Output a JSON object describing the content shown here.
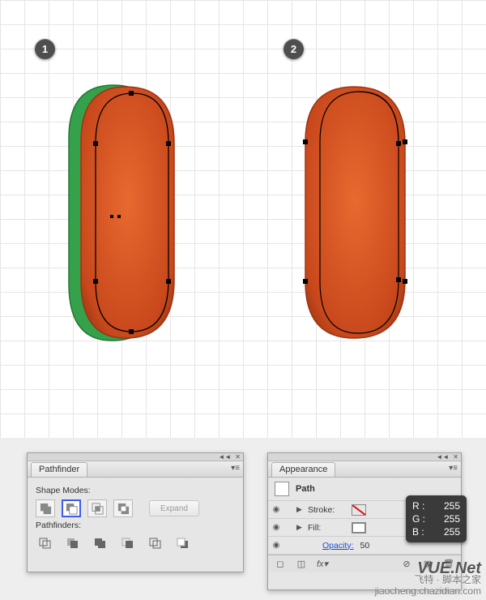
{
  "canvas": {
    "step1_label": "1",
    "step2_label": "2"
  },
  "pathfinder": {
    "tab": "Pathfinder",
    "shape_modes_label": "Shape Modes:",
    "expand_label": "Expand",
    "pathfinders_label": "Pathfinders:",
    "modes": [
      "unite",
      "minus-front",
      "intersect",
      "exclude"
    ],
    "active_mode_index": 1,
    "ops": [
      "divide",
      "trim",
      "merge",
      "crop",
      "outline",
      "minus-back"
    ]
  },
  "appearance": {
    "tab": "Appearance",
    "object_type": "Path",
    "rows": {
      "stroke_label": "Stroke:",
      "fill_label": "Fill:",
      "opacity_label": "Opacity:",
      "opacity_value": "50"
    },
    "footer_icons": [
      "no-style",
      "duplicate",
      "fx",
      "clear",
      "new",
      "delete"
    ]
  },
  "rgb": {
    "r_label": "R :",
    "g_label": "G :",
    "b_label": "B :",
    "r": "255",
    "g": "255",
    "b": "255"
  },
  "watermark": {
    "line1": "飞特 · 脚本之家",
    "line2": "jiaocheng.chazidian.com",
    "big": "VUE.Net"
  }
}
